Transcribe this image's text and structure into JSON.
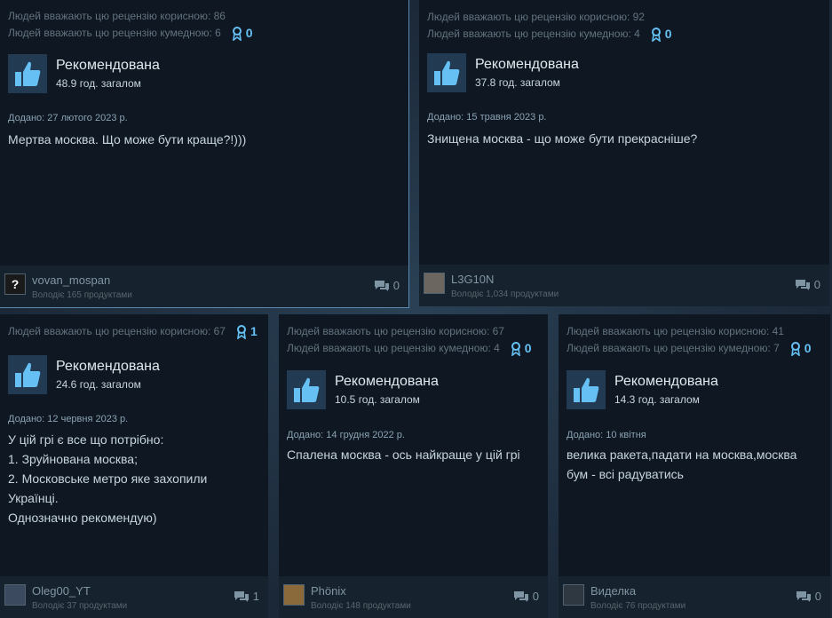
{
  "reviews": [
    {
      "helpful": "Людей вважають цю рецензію корисною: 86",
      "funny": "Людей вважають цю рецензію кумедною: 6",
      "awards": "0",
      "recommend": "Рекомендована",
      "hours": "48.9 год. загалом",
      "posted": "Додано: 27 лютого 2023 р.",
      "text": [
        "Мертва москва. Що може бути краще?!)))"
      ],
      "username": "vovan_mospan",
      "owns": "Володіє 165 продуктами",
      "comments": "0",
      "avatar_glyph": "?"
    },
    {
      "helpful": "Людей вважають цю рецензію корисною: 92",
      "funny": "Людей вважають цю рецензію кумедною: 4",
      "awards": "0",
      "recommend": "Рекомендована",
      "hours": "37.8 год. загалом",
      "posted": "Додано: 15 травня 2023 р.",
      "text": [
        "Знищена москва - що може бути прекрасніше?"
      ],
      "username": "L3G10N",
      "owns": "Володіє 1,034 продуктами",
      "comments": "0",
      "avatar_glyph": ""
    },
    {
      "helpful": "Людей вважають цю рецензію корисною: 67",
      "awards": "1",
      "recommend": "Рекомендована",
      "hours": "24.6 год. загалом",
      "posted": "Додано: 12 червня 2023 р.",
      "text": [
        "У цій грі є все що потрібно:",
        "1. Зруйнована москва;",
        "2. Московське метро яке захопили",
        "Українці.",
        "Однозначно рекомендую)"
      ],
      "username": "Oleg00_YT",
      "owns": "Володіє 37 продуктами",
      "comments": "1",
      "avatar_glyph": ""
    },
    {
      "helpful": "Людей вважають цю рецензію корисною: 67",
      "funny": "Людей вважають цю рецензію кумедною: 4",
      "awards": "0",
      "recommend": "Рекомендована",
      "hours": "10.5 год. загалом",
      "posted": "Додано: 14 грудня 2022 р.",
      "text": [
        "Спалена москва - ось найкраще у цій грі"
      ],
      "username": "Phönix",
      "owns": "Володіє 148 продуктами",
      "comments": "0",
      "avatar_glyph": ""
    },
    {
      "helpful": "Людей вважають цю рецензію корисною: 41",
      "funny": "Людей вважають цю рецензію кумедною: 7",
      "awards": "0",
      "recommend": "Рекомендована",
      "hours": "14.3 год. загалом",
      "posted": "Додано: 10 квітня",
      "text": [
        "велика ракета,падати на москва,москва",
        "бум - всі радуватись"
      ],
      "username": "Виделка",
      "owns": "Володіє 76 продуктами",
      "comments": "0",
      "avatar_glyph": ""
    }
  ],
  "colors": {
    "accent": "#66c0f4",
    "card_bg": "#0f1822",
    "footer_bg": "#16222d",
    "page_bg": "#1b2838"
  },
  "icons": {
    "thumb": "thumbs-up-icon",
    "award": "award-ribbon-icon",
    "comment": "comment-bubble-icon"
  }
}
